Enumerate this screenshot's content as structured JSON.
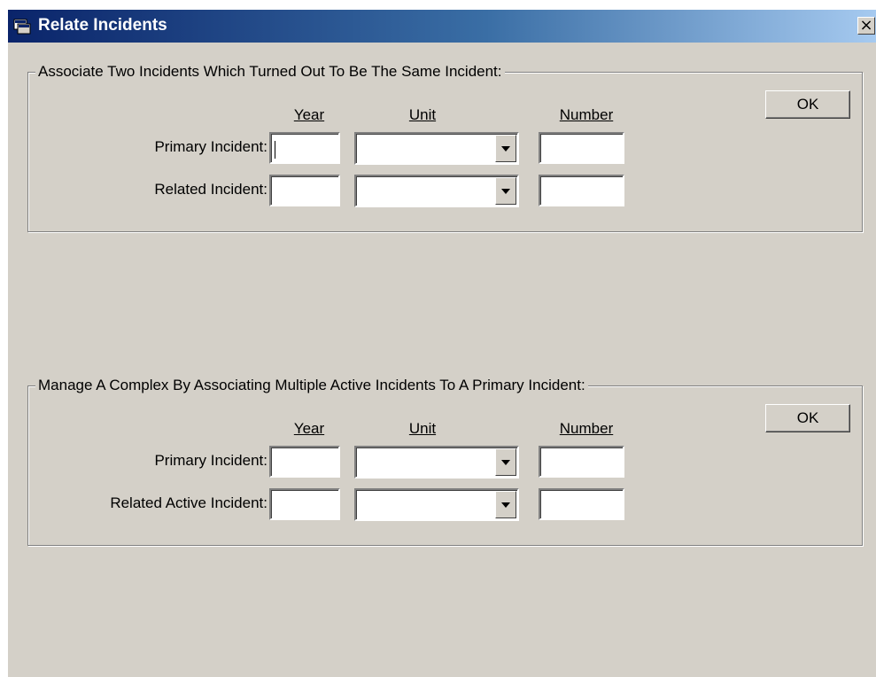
{
  "window": {
    "title": "Relate Incidents",
    "close_glyph": "×"
  },
  "group1": {
    "legend": "Associate Two Incidents Which Turned Out To Be The Same Incident:",
    "columns": {
      "year": "Year",
      "unit": "Unit",
      "number": "Number"
    },
    "rows": [
      {
        "label": "Primary Incident:",
        "year": "",
        "unit": "",
        "number": ""
      },
      {
        "label": "Related Incident:",
        "year": "",
        "unit": "",
        "number": ""
      }
    ],
    "ok_label": "OK"
  },
  "group2": {
    "legend": "Manage A Complex By Associating Multiple Active Incidents To A Primary Incident:",
    "columns": {
      "year": "Year",
      "unit": "Unit",
      "number": "Number"
    },
    "rows": [
      {
        "label": "Primary Incident:",
        "year": "",
        "unit": "",
        "number": ""
      },
      {
        "label": "Related Active Incident:",
        "year": "",
        "unit": "",
        "number": ""
      }
    ],
    "ok_label": "OK"
  }
}
